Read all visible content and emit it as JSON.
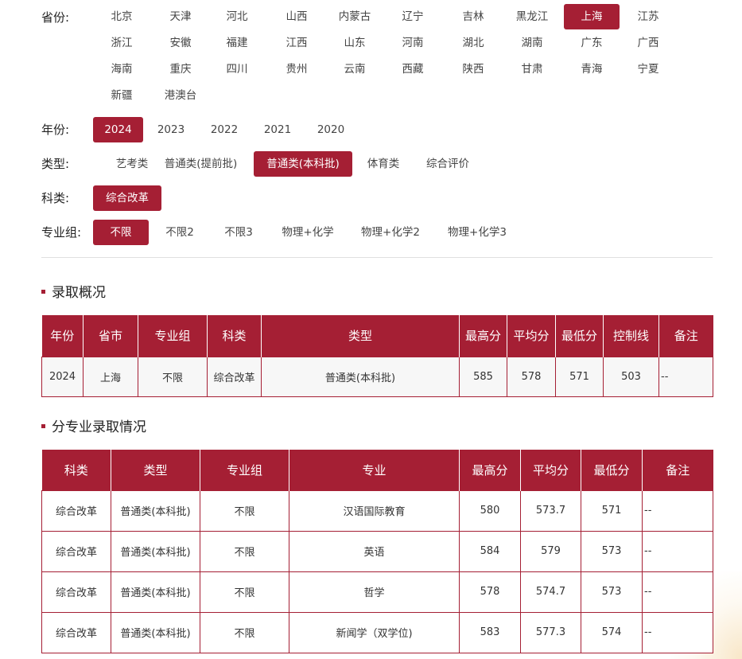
{
  "filters": {
    "province": {
      "label": "省份:",
      "options": [
        "北京",
        "天津",
        "河北",
        "山西",
        "内蒙古",
        "辽宁",
        "吉林",
        "黑龙江",
        "上海",
        "江苏",
        "浙江",
        "安徽",
        "福建",
        "江西",
        "山东",
        "河南",
        "湖北",
        "湖南",
        "广东",
        "广西",
        "海南",
        "重庆",
        "四川",
        "贵州",
        "云南",
        "西藏",
        "陕西",
        "甘肃",
        "青海",
        "宁夏",
        "新疆",
        "港澳台"
      ],
      "selected": "上海"
    },
    "year": {
      "label": "年份:",
      "options": [
        "2024",
        "2023",
        "2022",
        "2021",
        "2020"
      ],
      "selected": "2024"
    },
    "type": {
      "label": "类型:",
      "options": [
        "艺考类",
        "普通类(提前批)",
        "普通类(本科批)",
        "体育类",
        "综合评价"
      ],
      "selected": "普通类(本科批)"
    },
    "subject": {
      "label": "科类:",
      "options": [
        "综合改革"
      ],
      "selected": "综合改革"
    },
    "group": {
      "label": "专业组:",
      "options": [
        "不限",
        "不限2",
        "不限3",
        "物理+化学",
        "物理+化学2",
        "物理+化学3"
      ],
      "selected": "不限"
    }
  },
  "colors": {
    "accent": "#a51f34"
  },
  "overview": {
    "title": "录取概况",
    "headers": [
      "年份",
      "省市",
      "专业组",
      "科类",
      "类型",
      "最高分",
      "平均分",
      "最低分",
      "控制线",
      "备注"
    ],
    "rows": [
      [
        "2024",
        "上海",
        "不限",
        "综合改革",
        "普通类(本科批)",
        "585",
        "578",
        "571",
        "503",
        "--"
      ]
    ]
  },
  "majors": {
    "title": "分专业录取情况",
    "headers": [
      "科类",
      "类型",
      "专业组",
      "专业",
      "最高分",
      "平均分",
      "最低分",
      "备注"
    ],
    "rows": [
      [
        "综合改革",
        "普通类(本科批)",
        "不限",
        "汉语国际教育",
        "580",
        "573.7",
        "571",
        "--"
      ],
      [
        "综合改革",
        "普通类(本科批)",
        "不限",
        "英语",
        "584",
        "579",
        "573",
        "--"
      ],
      [
        "综合改革",
        "普通类(本科批)",
        "不限",
        "哲学",
        "578",
        "574.7",
        "573",
        "--"
      ],
      [
        "综合改革",
        "普通类(本科批)",
        "不限",
        "新闻学（双学位)",
        "583",
        "577.3",
        "574",
        "--"
      ]
    ]
  }
}
